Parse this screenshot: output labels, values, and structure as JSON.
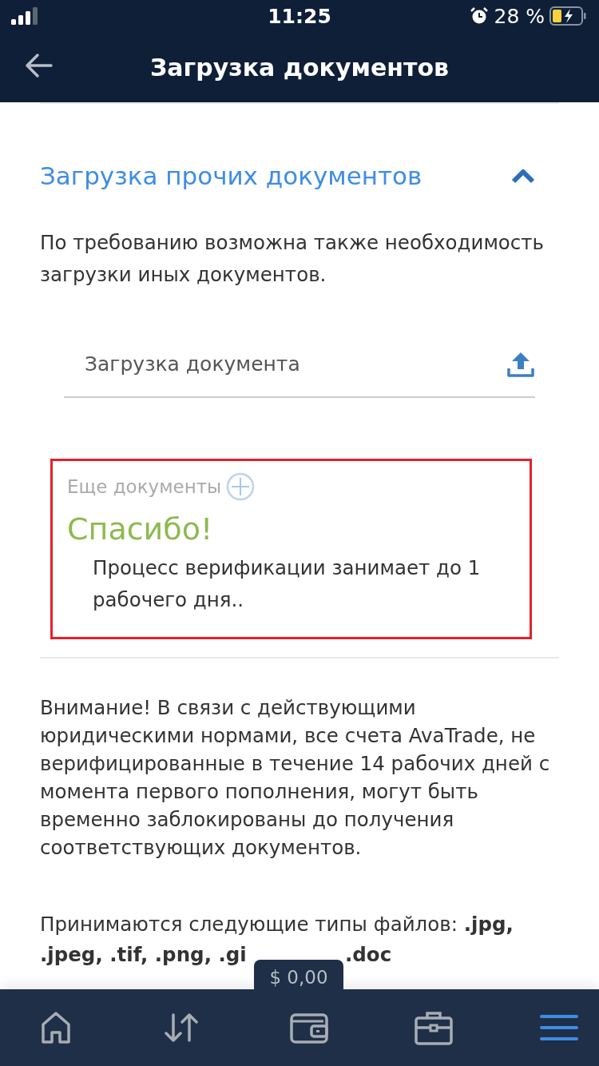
{
  "status_bar": {
    "time": "11:25",
    "battery": "28 %"
  },
  "header": {
    "title": "Загрузка документов"
  },
  "section": {
    "title": "Загрузка прочих документов",
    "expanded": true,
    "description": "По требованию возможна также необходимость загрузки иных документов.",
    "upload_field": {
      "placeholder": "Загрузка документа"
    }
  },
  "more_documents": {
    "label": "Еще документы"
  },
  "thanks": {
    "title": "Спасибо!",
    "message": "Процесс верификации занимает до 1 рабочего дня.."
  },
  "notice": "Внимание! В связи с действующими юридическими нормами, все счета AvaTrade, не верифицированные в течение 14 рабочих дней с момента первого пополнения, могут быть временно заблокированы до получения соответствующих документов.",
  "file_types": {
    "line_1": "Принимаются следующие типы файлов: **.jpg,**",
    "line_2": ".jpeg, .tif, .png, .gi",
    "line_2_end": ".doc"
  },
  "balance": "$ 0,00",
  "nav": [
    {
      "kind": "home",
      "selected": false
    },
    {
      "kind": "transfer",
      "selected": false
    },
    {
      "kind": "wallet",
      "selected": false
    },
    {
      "kind": "portfolio",
      "selected": false
    },
    {
      "kind": "menu",
      "selected": true
    }
  ]
}
